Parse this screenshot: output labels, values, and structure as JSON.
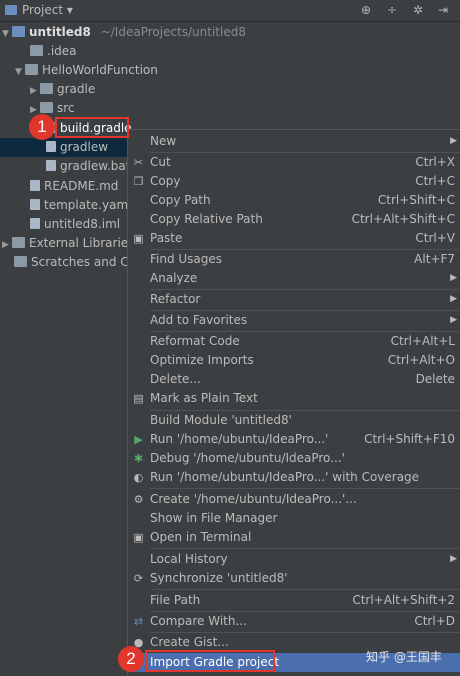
{
  "header": {
    "title": "Project"
  },
  "tree": {
    "root_name": "untitled8",
    "root_path": "~/IdeaProjects/untitled8",
    "items": [
      {
        "label": ".idea"
      },
      {
        "label": "HelloWorldFunction"
      },
      {
        "label": "gradle"
      },
      {
        "label": "src"
      },
      {
        "label": "build.gradle"
      },
      {
        "label": "gradlew"
      },
      {
        "label": "gradlew.bat"
      },
      {
        "label": "README.md"
      },
      {
        "label": "template.yaml"
      },
      {
        "label": "untitled8.iml"
      },
      {
        "label": "External Libraries"
      },
      {
        "label": "Scratches and Co"
      }
    ]
  },
  "callouts": [
    "1",
    "2"
  ],
  "menu": {
    "items": [
      {
        "label": "New",
        "shortcut": ""
      },
      {
        "label": "Cut",
        "shortcut": "Ctrl+X"
      },
      {
        "label": "Copy",
        "shortcut": "Ctrl+C"
      },
      {
        "label": "Copy Path",
        "shortcut": "Ctrl+Shift+C"
      },
      {
        "label": "Copy Relative Path",
        "shortcut": "Ctrl+Alt+Shift+C"
      },
      {
        "label": "Paste",
        "shortcut": "Ctrl+V"
      },
      {
        "label": "Find Usages",
        "shortcut": "Alt+F7"
      },
      {
        "label": "Analyze",
        "shortcut": ""
      },
      {
        "label": "Refactor",
        "shortcut": ""
      },
      {
        "label": "Add to Favorites",
        "shortcut": ""
      },
      {
        "label": "Reformat Code",
        "shortcut": "Ctrl+Alt+L"
      },
      {
        "label": "Optimize Imports",
        "shortcut": "Ctrl+Alt+O"
      },
      {
        "label": "Delete...",
        "shortcut": "Delete"
      },
      {
        "label": "Mark as Plain Text",
        "shortcut": ""
      },
      {
        "label": "Build Module 'untitled8'",
        "shortcut": ""
      },
      {
        "label": "Run '/home/ubuntu/IdeaPro...'",
        "shortcut": "Ctrl+Shift+F10"
      },
      {
        "label": "Debug '/home/ubuntu/IdeaPro...'",
        "shortcut": ""
      },
      {
        "label": "Run '/home/ubuntu/IdeaPro...' with Coverage",
        "shortcut": ""
      },
      {
        "label": "Create '/home/ubuntu/IdeaPro...'...",
        "shortcut": ""
      },
      {
        "label": "Show in File Manager",
        "shortcut": ""
      },
      {
        "label": "Open in Terminal",
        "shortcut": ""
      },
      {
        "label": "Local History",
        "shortcut": ""
      },
      {
        "label": "Synchronize 'untitled8'",
        "shortcut": ""
      },
      {
        "label": "File Path",
        "shortcut": "Ctrl+Alt+Shift+2"
      },
      {
        "label": "Compare With...",
        "shortcut": "Ctrl+D"
      },
      {
        "label": "Create Gist...",
        "shortcut": ""
      },
      {
        "label": "Import Gradle project",
        "shortcut": ""
      }
    ]
  },
  "watermark": "知乎 @王国丰"
}
